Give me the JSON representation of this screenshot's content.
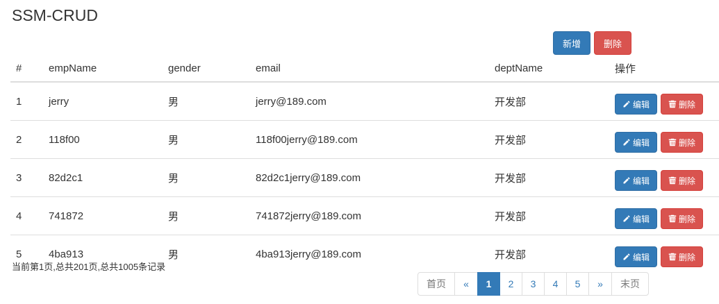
{
  "title": "SSM-CRUD",
  "top_actions": {
    "add_label": "新增",
    "delete_label": "删除"
  },
  "table": {
    "headers": [
      "#",
      "empName",
      "gender",
      "email",
      "deptName",
      "操作"
    ],
    "rows": [
      {
        "id": "1",
        "name": "jerry",
        "gender": "男",
        "email": "jerry@189.com",
        "dept": "开发部"
      },
      {
        "id": "2",
        "name": "118f00",
        "gender": "男",
        "email": "118f00jerry@189.com",
        "dept": "开发部"
      },
      {
        "id": "3",
        "name": "82d2c1",
        "gender": "男",
        "email": "82d2c1jerry@189.com",
        "dept": "开发部"
      },
      {
        "id": "4",
        "name": "741872",
        "gender": "男",
        "email": "741872jerry@189.com",
        "dept": "开发部"
      },
      {
        "id": "5",
        "name": "4ba913",
        "gender": "男",
        "email": "4ba913jerry@189.com",
        "dept": "开发部"
      }
    ],
    "edit_label": "编辑",
    "delete_label": "删除"
  },
  "page_info": "当前第1页,总共201页,总共1005条记录",
  "pagination": {
    "first": "首页",
    "prev": "«",
    "pages": [
      "1",
      "2",
      "3",
      "4",
      "5"
    ],
    "active_page": "1",
    "next": "»",
    "last": "末页"
  },
  "colors": {
    "primary": "#337ab7",
    "danger": "#d9534f"
  },
  "icons": {
    "edit": "pencil-icon",
    "delete": "trash-icon"
  }
}
